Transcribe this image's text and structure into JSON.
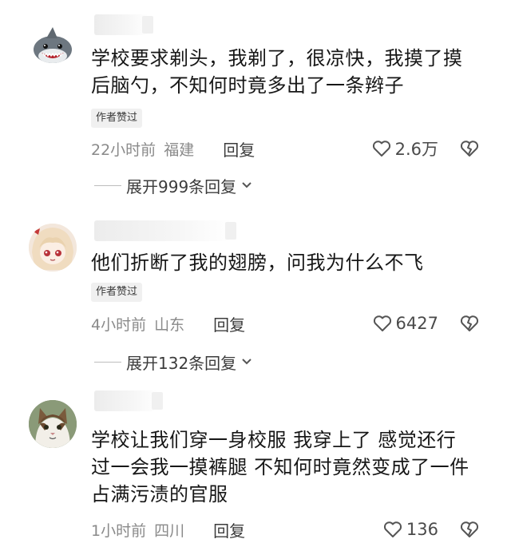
{
  "comments": [
    {
      "avatar": "shark-avatar",
      "text": "学校要求剃头，我剃了，很凉快，我摸了摸后脑勺，不知何时竟多出了一条辫子",
      "badge": "作者赞过",
      "time": "22小时前",
      "region": "福建",
      "reply": "回复",
      "likes": "2.6万",
      "expand": "展开999条回复"
    },
    {
      "avatar": "anime-girl-avatar",
      "text": "他们折断了我的翅膀，问我为什么不飞",
      "badge": "作者赞过",
      "time": "4小时前",
      "region": "山东",
      "reply": "回复",
      "likes": "6427",
      "expand": "展开132条回复"
    },
    {
      "avatar": "cat-avatar",
      "text": "学校让我们穿一身校服 我穿上了 感觉还行 过一会我一摸裤腿 不知何时竟然变成了一件占满污渍的官服",
      "time": "1小时前",
      "region": "四川",
      "reply": "回复",
      "likes": "136"
    }
  ],
  "icons": {
    "like": "heart-outline-icon",
    "dislike": "broken-heart-icon",
    "expand": "chevron-down-icon"
  },
  "colors": {
    "text": "#171717",
    "meta": "#8a8a8a",
    "badge_bg": "#f0f0f0"
  }
}
